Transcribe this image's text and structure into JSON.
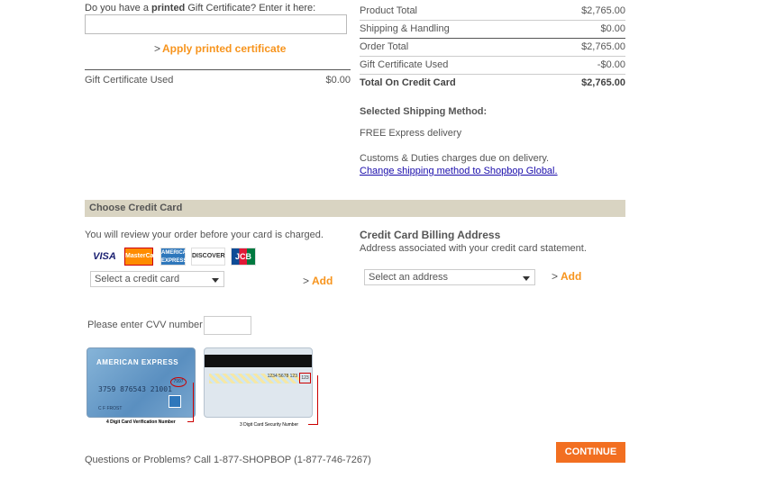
{
  "gift_certificate": {
    "prompt_prefix": "Do you have a ",
    "prompt_bold": "printed",
    "prompt_suffix": " Gift Certificate? Enter it here:",
    "input_value": "",
    "apply_label": "Apply printed certificate",
    "used_label": "Gift Certificate Used",
    "used_value": "$0.00"
  },
  "order_summary": {
    "rows": [
      {
        "label": "Product Total",
        "value": "$2,765.00"
      },
      {
        "label": "Shipping & Handling",
        "value": "$0.00"
      },
      {
        "label": "Order Total",
        "value": "$2,765.00"
      },
      {
        "label": "Gift Certificate Used",
        "value": "-$0.00"
      },
      {
        "label": "Total On Credit Card",
        "value": "$2,765.00"
      }
    ]
  },
  "shipping": {
    "title": "Selected Shipping Method:",
    "method": "FREE Express delivery",
    "customs_note": "Customs & Duties charges due on delivery.",
    "change_link": "Change shipping method to Shopbop Global."
  },
  "credit_card": {
    "header": "Choose Credit Card",
    "review_note": "You will review your order before your card is charged.",
    "logos": [
      "VISA",
      "MasterCard",
      "AMERICAN EXPRESS",
      "DISCOVER",
      "JCB"
    ],
    "select_value": "Select a credit card",
    "add_label": "Add",
    "cvv_label": "Please enter CVV number",
    "cvv_value": "",
    "amex_brand": "AMERICAN EXPRESS",
    "amex_number": "3759 876543 21001",
    "amex_cid": "7997",
    "amex_holder": "C F FROST",
    "amex_caption": "4 Digit Card Verification Number",
    "back_sig": "1234 5678 123",
    "back_cvv": "123",
    "back_caption": "3 Digit Card Security Number"
  },
  "billing": {
    "title": "Credit Card Billing Address",
    "subtitle": "Address associated with your credit card statement.",
    "select_value": "Select an address",
    "add_label": "Add"
  },
  "footer": {
    "questions": "Questions or Problems? Call 1-877-SHOPBOP (1-877-746-7267)",
    "continue_label": "CONTINUE"
  },
  "colors": {
    "accent_orange": "#f7941d",
    "continue_bg": "#f26f21",
    "section_header_bg": "#d9d4c2",
    "link_blue": "#1a0dab"
  }
}
